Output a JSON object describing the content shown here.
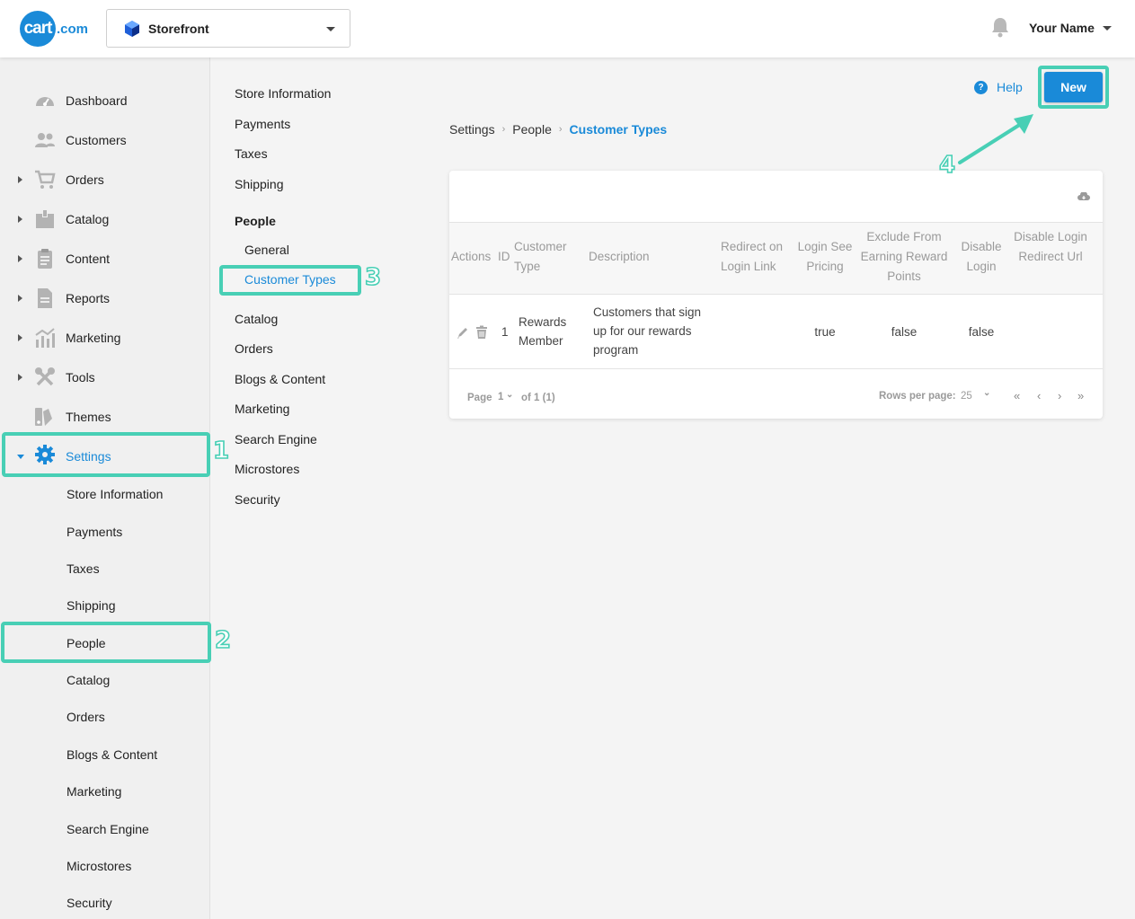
{
  "topbar": {
    "logo_text": "cart",
    "logo_suffix": ".com",
    "store_name": "Storefront",
    "user_name": "Your Name"
  },
  "sidebar": {
    "items": [
      {
        "label": "Dashboard",
        "icon": "dashboard-icon",
        "expandable": false
      },
      {
        "label": "Customers",
        "icon": "customers-icon",
        "expandable": false
      },
      {
        "label": "Orders",
        "icon": "cart-icon",
        "expandable": true
      },
      {
        "label": "Catalog",
        "icon": "catalog-icon",
        "expandable": true
      },
      {
        "label": "Content",
        "icon": "content-icon",
        "expandable": true
      },
      {
        "label": "Reports",
        "icon": "reports-icon",
        "expandable": true
      },
      {
        "label": "Marketing",
        "icon": "marketing-icon",
        "expandable": true
      },
      {
        "label": "Tools",
        "icon": "tools-icon",
        "expandable": true
      },
      {
        "label": "Themes",
        "icon": "themes-icon",
        "expandable": false
      },
      {
        "label": "Settings",
        "icon": "gear-icon",
        "expandable": true,
        "active": true
      }
    ],
    "settings_sub": [
      "Store Information",
      "Payments",
      "Taxes",
      "Shipping",
      "People",
      "Catalog",
      "Orders",
      "Blogs & Content",
      "Marketing",
      "Search Engine",
      "Microstores",
      "Security"
    ]
  },
  "settings_menu": {
    "items_top": [
      "Store Information",
      "Payments",
      "Taxes",
      "Shipping"
    ],
    "people_heading": "People",
    "people_sub": [
      "General",
      "Customer Types"
    ],
    "items_bottom": [
      "Catalog",
      "Orders",
      "Blogs & Content",
      "Marketing",
      "Search Engine",
      "Microstores",
      "Security"
    ]
  },
  "main": {
    "help_label": "Help",
    "new_label": "New",
    "breadcrumb": [
      "Settings",
      "People",
      "Customer Types"
    ],
    "table": {
      "headers": {
        "actions": "Actions",
        "id": "ID",
        "customer_type": "Customer Type",
        "description": "Description",
        "redirect": "Redirect on Login Link",
        "login_see_pricing": "Login See Pricing",
        "exclude": "Exclude From Earning Reward Points",
        "disable_login": "Disable Login",
        "disable_login_redirect": "Disable Login Redirect Url"
      },
      "rows": [
        {
          "id": "1",
          "customer_type": "Rewards Member",
          "description": "Customers that sign up for our rewards program",
          "redirect": "",
          "login_see_pricing": "true",
          "exclude": "false",
          "disable_login": "false",
          "disable_login_redirect": ""
        }
      ]
    },
    "pagination": {
      "page_label": "Page",
      "page_value": "1",
      "of_label": "of 1 (1)",
      "rows_label": "Rows per page:",
      "rows_value": "25"
    }
  },
  "annotations": [
    "1",
    "2",
    "3",
    "4"
  ],
  "colors": {
    "accent": "#1a8ad8",
    "highlight": "#48cfb5"
  }
}
